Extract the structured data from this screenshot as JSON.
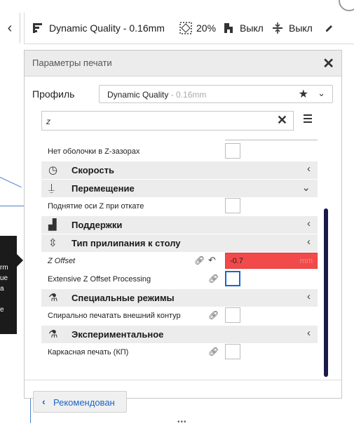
{
  "topbar": {
    "back_icon": "chevron-left-icon",
    "quality": "Dynamic Quality - 0.16mm",
    "infill": "20%",
    "support": "Выкл",
    "adhesion": "Выкл"
  },
  "dialog": {
    "title": "Параметры печати",
    "profile_label": "Профиль",
    "profile_name": "Dynamic Quality",
    "profile_sub": " - 0.16mm",
    "search_value": "z",
    "rows": {
      "r1": "Нет оболочки в Z-зазорах",
      "cat_speed": "Скорость",
      "cat_travel": "Перемещение",
      "r2": "Поднятие оси Z при откате",
      "cat_support": "Поддержки",
      "cat_adhesion": "Тип прилипания к столу",
      "z_offset_label": "Z Offset",
      "z_offset_value": "-0.7",
      "z_offset_unit": "mm",
      "r4": "Extensive Z Offset Processing",
      "cat_special": "Специальные режимы",
      "r5": "Спирально печатать внешний контур",
      "cat_experimental": "Экспериментальное",
      "r6": "Каркасная печать (КП)"
    },
    "recommended_button": "Рекомендован",
    "grip": "•••"
  },
  "tooltip": {
    "lines": [
      "rm",
      "ue",
      "a",
      "",
      "e"
    ]
  },
  "colors": {
    "accent": "#1a66c8",
    "error_field": "#f24a4a",
    "scrollbar": "#1a1a4a"
  }
}
